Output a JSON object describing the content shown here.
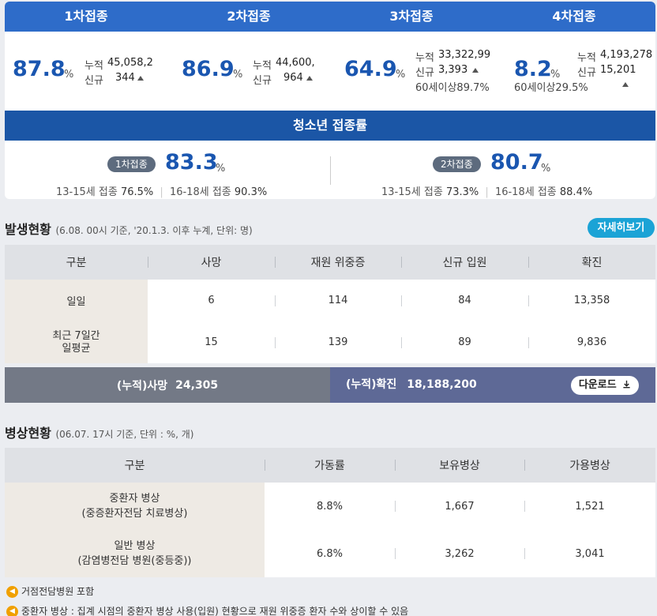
{
  "vaccination": {
    "doses": [
      {
        "title": "1차접종",
        "rate": "87.8",
        "unit": "%",
        "cum_label": "누적",
        "cum_value": "45,058,2",
        "new_label": "신규",
        "new_value": "344"
      },
      {
        "title": "2차접종",
        "rate": "86.9",
        "unit": "%",
        "cum_label": "누적",
        "cum_value": "44,600,",
        "new_label": "신규",
        "new_value": "964"
      },
      {
        "title": "3차접종",
        "rate": "64.9",
        "unit": "%",
        "cum_label": "누적",
        "cum_value": "33,322,99",
        "new_label": "신규",
        "new_value": "3,393",
        "extra": "60세이상89.7%"
      },
      {
        "title": "4차접종",
        "rate": "8.2",
        "unit": "%",
        "cum_label": "누적",
        "cum_value": "4,193,278",
        "new_label": "신규",
        "new_value": "15,201",
        "extra": "60세이상29.5%"
      }
    ],
    "teen": {
      "title": "청소년 접종률",
      "first": {
        "badge": "1차접종",
        "rate": "83.3",
        "unit": "%",
        "a_age": "13-15세",
        "a_label": "접종",
        "a_value": "76.5%",
        "b_age": "16-18세",
        "b_label": "접종",
        "b_value": "90.3%"
      },
      "second": {
        "badge": "2차접종",
        "rate": "80.7",
        "unit": "%",
        "a_age": "13-15세",
        "a_label": "접종",
        "a_value": "73.3%",
        "b_age": "16-18세",
        "b_label": "접종",
        "b_value": "88.4%"
      }
    }
  },
  "occurrence": {
    "title": "발생현황",
    "subtitle": "(6.08. 00시 기준, '20.1.3. 이후 누계, 단위: 명)",
    "detail_button": "자세히보기",
    "headers": [
      "구분",
      "사망",
      "재원 위중증",
      "신규 입원",
      "확진"
    ],
    "rows": [
      {
        "label": "일일",
        "values": [
          "6",
          "114",
          "84",
          "13,358"
        ]
      },
      {
        "label_l1": "최근 7일간",
        "label_l2": "일평균",
        "values": [
          "15",
          "139",
          "89",
          "9,836"
        ]
      }
    ],
    "cumulative": {
      "death_label": "(누적)사망",
      "death_value": "24,305",
      "confirmed_label": "(누적)확진",
      "confirmed_value": "18,188,200",
      "download_button": "다운로드"
    }
  },
  "beds": {
    "title": "병상현황",
    "subtitle": "(06.07. 17시 기준, 단위 : %, 개)",
    "headers": [
      "구분",
      "가동률",
      "보유병상",
      "가용병상"
    ],
    "rows": [
      {
        "l1": "중환자 병상",
        "l2": "(중증환자전담 치료병상)",
        "values": [
          "8.8%",
          "1,667",
          "1,521"
        ]
      },
      {
        "l1": "일반 병상",
        "l2": "(감염병전담 병원(중등중))",
        "values": [
          "6.8%",
          "3,262",
          "3,041"
        ]
      }
    ]
  },
  "notes": [
    "거점전담병원 포함",
    "중환자 병상 : 집계 시점의 중환자 병상 사용(입원) 현황으로 재원 위중증 환자 수와 상이할 수 있음"
  ],
  "colors": {
    "primary": "#2e6cc9",
    "teen_bar": "#1b56a6",
    "rate": "#1a56b0",
    "detail_button": "#1ba3d6",
    "death_bar": "#737986",
    "confirmed_bar": "#5e6996",
    "note_icon": "#f0a000"
  }
}
